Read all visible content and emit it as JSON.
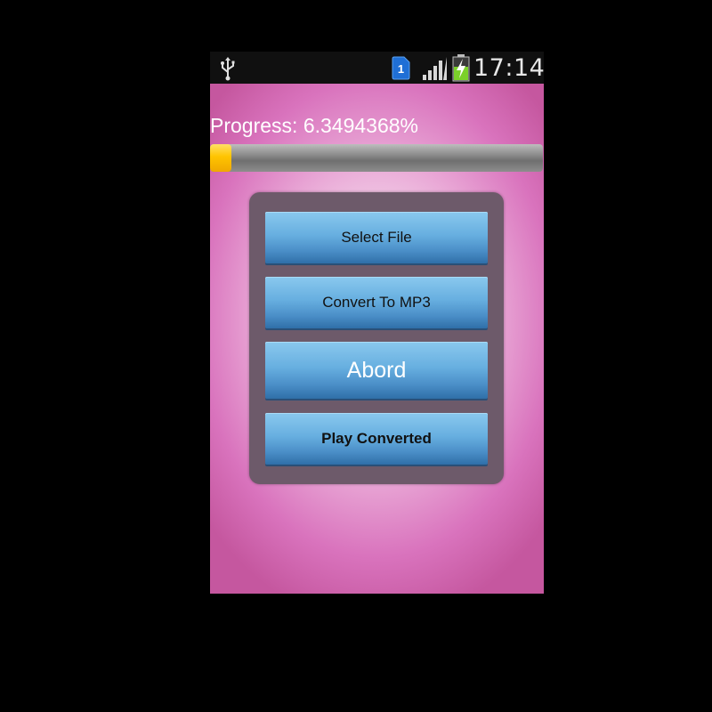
{
  "status_bar": {
    "time": "17:14",
    "sim_slot": "1",
    "icons": [
      "usb-icon",
      "sim-icon",
      "signal-icon",
      "battery-charging-icon"
    ],
    "battery_color": "#7bd12a",
    "sim_color": "#1f6fd6"
  },
  "progress": {
    "label": "Progress: 6.3494368%",
    "fraction": 0.063494368,
    "fill_color": "#ffc400"
  },
  "buttons": {
    "select_file": "Select File",
    "convert_to_mp3": "Convert To MP3",
    "abord": "Abord",
    "play_converted": "Play Converted"
  },
  "colors": {
    "button_blue": "#67afe0",
    "panel": "#6d5a6a",
    "background_pink": "#d973bd"
  }
}
